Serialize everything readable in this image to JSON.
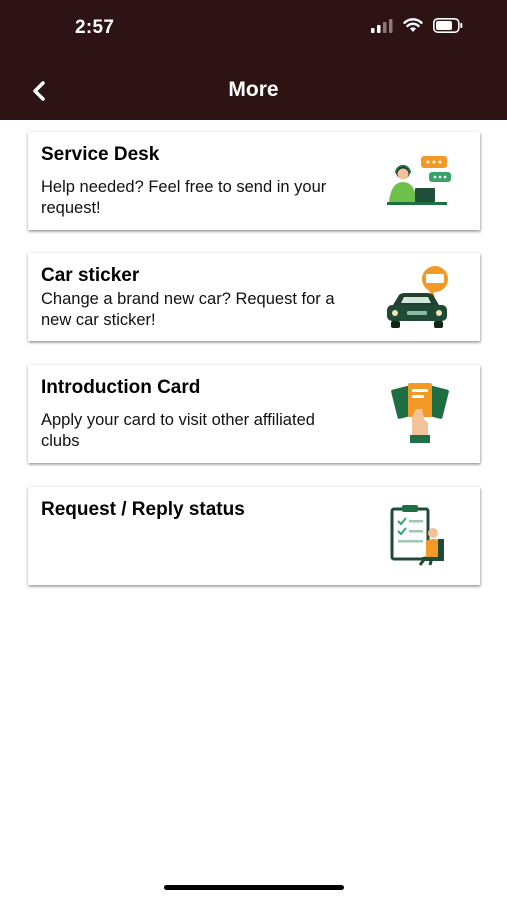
{
  "status_bar": {
    "time": "2:57"
  },
  "header": {
    "title": "More"
  },
  "cards": [
    {
      "title": "Service Desk",
      "description": "Help needed? Feel free to send in your request!",
      "icon": "customer-support-icon"
    },
    {
      "title": "Car sticker",
      "description": "Change a brand new car? Request for a new car sticker!",
      "icon": "car-sticker-icon"
    },
    {
      "title": "Introduction Card",
      "description": "Apply your card to visit other affiliated clubs",
      "icon": "introduction-card-icon"
    },
    {
      "title": "Request / Reply status",
      "description": "",
      "icon": "request-status-icon"
    }
  ],
  "colors": {
    "header_bg": "#2d1313",
    "accent_orange": "#f39a26",
    "accent_green": "#1f6f45"
  }
}
